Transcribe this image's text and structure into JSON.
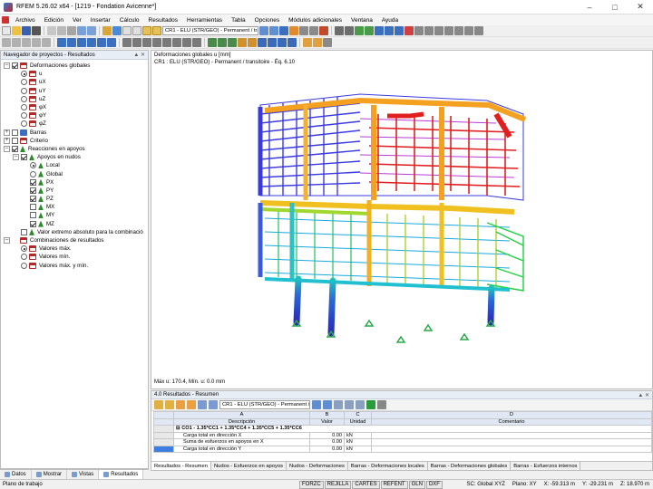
{
  "window": {
    "title": "RFEM 5.26.02 x64 - [1219 - Fondation Avicenne*]"
  },
  "menu": [
    "Archivo",
    "Edición",
    "Ver",
    "Insertar",
    "Cálculo",
    "Resultados",
    "Herramientas",
    "Tabla",
    "Opciones",
    "Módulos adicionales",
    "Ventana",
    "Ayuda"
  ],
  "toolbar": {
    "load_case": "CR1 - ELU (STR/GEO) - Permanent / trar"
  },
  "navigator": {
    "title": "Navegador de proyectos - Resultados",
    "items": [
      {
        "label": "Deformaciones globales"
      },
      {
        "label": "u"
      },
      {
        "label": "uX"
      },
      {
        "label": "uY"
      },
      {
        "label": "uZ"
      },
      {
        "label": "φX"
      },
      {
        "label": "φY"
      },
      {
        "label": "φZ"
      },
      {
        "label": "Barras"
      },
      {
        "label": "Criterio"
      },
      {
        "label": "Reacciones en apoyos"
      },
      {
        "label": "Apoyos en nudos"
      },
      {
        "label": "Local"
      },
      {
        "label": "Global"
      },
      {
        "label": "PX"
      },
      {
        "label": "PY"
      },
      {
        "label": "PZ"
      },
      {
        "label": "MX"
      },
      {
        "label": "MY"
      },
      {
        "label": "MZ"
      },
      {
        "label": "Valor extremo absoluto para la combinació"
      },
      {
        "label": "Combinaciones de resultados"
      },
      {
        "label": "Valores máx."
      },
      {
        "label": "Valores mín."
      },
      {
        "label": "Valores máx. y mín."
      }
    ],
    "tabs": [
      "Datos",
      "Mostrar",
      "Vistas",
      "Resultados"
    ]
  },
  "viewport": {
    "line1": "Deformaciones globales u [mm]",
    "line2": "CR1 : ELU (STR/GEO) - Permanent / transitoire - Éq. 6.10",
    "footer": "Máx u: 170.4, Mín. u: 0.0 mm"
  },
  "results": {
    "title": "4.0 Resultados - Resumen",
    "load_case": "CR1 - ELU (STR/GEO) - Permanent /",
    "col_letters": [
      "A",
      "B",
      "C",
      "D"
    ],
    "headers": [
      "Descripción",
      "Valor",
      "Unidad",
      "Comentario"
    ],
    "group": "CO1 - 1.35*CC1 + 1.35*CC4 + 1.35*CC5 + 1.35*CC6",
    "rows": [
      {
        "desc": "Carga total en dirección X",
        "value": "0.00",
        "unit": "kN",
        "comment": ""
      },
      {
        "desc": "Suma de esfuerzos en apoyos en X",
        "value": "0.00",
        "unit": "kN",
        "comment": ""
      },
      {
        "desc": "Carga total en dirección Y",
        "value": "0.00",
        "unit": "kN",
        "comment": ""
      }
    ],
    "tabs": [
      "Resultados - Resumen",
      "Nudos - Esfuerzos en apoyos",
      "Nudos - Deformaciones",
      "Barras - Deformaciones locales",
      "Barras - Deformaciones globales",
      "Barras - Esfuerzos internos"
    ]
  },
  "statusbar": {
    "left": "Plano de trabajo",
    "toggles": [
      "FORZC",
      "REJILLA",
      "CARTES",
      "REFENT",
      "GLN",
      "DXF"
    ],
    "system": "SC: Global XYZ",
    "plane": "Plano: XY",
    "x": "X: -59.313 m",
    "y": "Y: -29.231 m",
    "z": "Z: 18.970 m"
  }
}
